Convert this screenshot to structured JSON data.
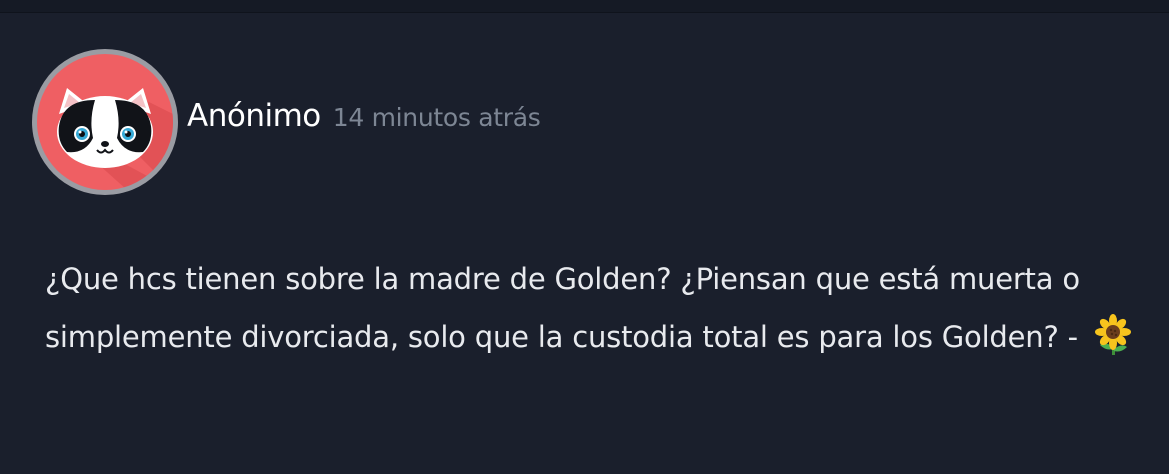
{
  "post": {
    "author": "Anónimo",
    "time": "14 minutos atrás",
    "body": "¿Que hcs tienen sobre la madre de Golden? ¿Piensan que está muerta o simplemente divorciada, solo que la custodia total es para los Golden? -",
    "emoji": "sunflower-icon"
  },
  "colors": {
    "background": "#1a1f2c",
    "avatar_bg": "#ef5f63",
    "avatar_ring": "#9a9ca3",
    "time_text": "#7d8694"
  }
}
